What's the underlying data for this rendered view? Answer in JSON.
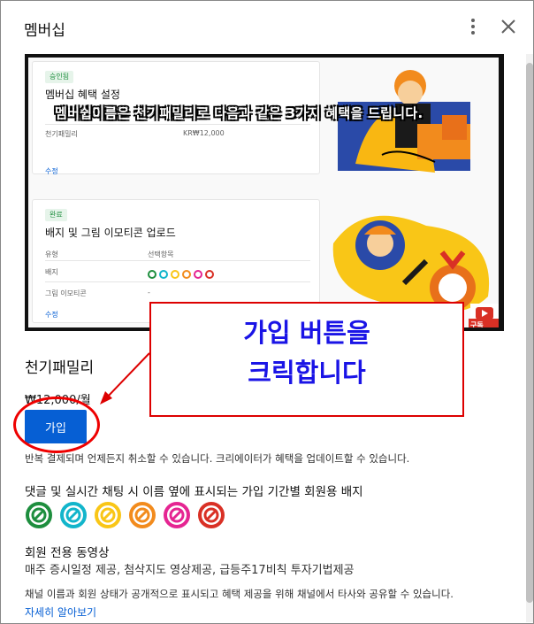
{
  "dialog": {
    "title": "멤버십",
    "menu_icon": "more-vert-icon",
    "close_icon": "close-icon"
  },
  "banner": {
    "subtitle_overlay": "멤버쉽이름은 천기패밀리로 다음과 같은 3가지 혜택을 드립니다.",
    "card1": {
      "chip": "승인됨",
      "title": "멤버십 혜택 설정",
      "row_name": "천기패밀리",
      "row_price": "KR₩12,000",
      "edit_link": "수정"
    },
    "card2": {
      "chip": "완료",
      "title": "배지 및 그림 이모티콘 업로드",
      "col_type": "유형",
      "col_choice": "선택항목",
      "row1": "배지",
      "row2": "그림 이모티콘",
      "row2_value": "-",
      "edit_link": "수정"
    },
    "subscribe_badge": "구독"
  },
  "plan": {
    "name": "천기패밀리",
    "price": "₩12,000/월",
    "join_label": "가입",
    "renew_note": "반복 결제되며 언제든지 취소할 수 있습니다. 크리에이터가 혜택을 업데이트할 수 있습니다."
  },
  "perks": {
    "badges_title": "댓글 및 실시간 채팅 시 이름 옆에 표시되는 가입 기간별 회원용 배지",
    "badge_colors": [
      "#1e8e3e",
      "#12b5cb",
      "#f9c617",
      "#f28b1d",
      "#e52592",
      "#d93025"
    ],
    "videos_title": "회원 전용 동영상",
    "videos_desc": "매주 증시일정 제공, 첨삭지도 영상제공, 급등주17비칙 투자기법제공"
  },
  "footer": {
    "disclaimer": "채널 이름과 회원 상태가 공개적으로 표시되고 혜택 제공을 위해 채널에서 타사와 공유할 수 있습니다.",
    "learn_more": "자세히 알아보기"
  },
  "annotation": {
    "line1": "가입 버튼을",
    "line2": "크릭합니다",
    "color": "#1a14e6",
    "border_color": "#dd0000"
  }
}
